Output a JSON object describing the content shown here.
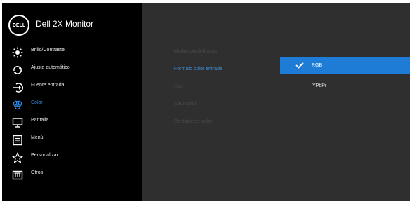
{
  "header": {
    "logo_text": "DELL",
    "title": "Dell 2X Monitor"
  },
  "menu": [
    {
      "label": "Brillo/Contraste",
      "icon": "brightness-icon"
    },
    {
      "label": "Ajuste automático",
      "icon": "auto-adjust-icon"
    },
    {
      "label": "Fuente entrada",
      "icon": "input-source-icon"
    },
    {
      "label": "Color",
      "icon": "color-icon",
      "active": true
    },
    {
      "label": "Pantalla",
      "icon": "display-icon"
    },
    {
      "label": "Menú",
      "icon": "menu-icon"
    },
    {
      "label": "Personalizar",
      "icon": "star-icon"
    },
    {
      "label": "Otros",
      "icon": "others-icon"
    }
  ],
  "submenu": [
    {
      "label": "Modos predefinidos"
    },
    {
      "label": "Formato color entrada",
      "active": true
    },
    {
      "label": "Hue"
    },
    {
      "label": "Saturación"
    },
    {
      "label": "Restablecer color"
    }
  ],
  "options": {
    "selected": "RGB",
    "other": "YPbPr"
  },
  "colors": {
    "accent": "#1f7cd6",
    "panel": "#2f2f2f",
    "sidebar": "#000000"
  }
}
